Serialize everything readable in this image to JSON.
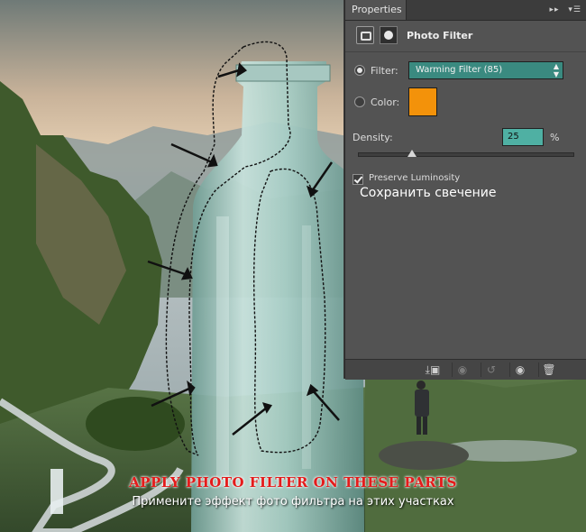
{
  "panel": {
    "tab": "Properties",
    "title": "Photo Filter",
    "filter_label": "Filter:",
    "filter_value": "Warming Filter (85)",
    "color_label": "Color:",
    "swatch_color": "#f3920a",
    "density_label": "Density:",
    "density_value": "25",
    "density_unit": "%",
    "density_level": 0.25,
    "preserve_label": "Preserve Luminosity",
    "preserve_checked": true,
    "preserve_ru": "Сохранить свечение"
  },
  "captions": {
    "en": "APPLY PHOTO FILTER ON THESE PARTS",
    "ru": "Примените эффект фото фильтра на этих участках"
  },
  "icons": [
    "adjustment-layer-icon",
    "layer-mask-icon",
    "clip-to-layer-icon",
    "view-previous-icon",
    "reset-icon",
    "visibility-eye-icon",
    "trash-icon",
    "panel-menu-icon",
    "collapse-panel-icon"
  ],
  "colors": {
    "accent_field": "#3a8a80",
    "accent_input": "#4fb0a3",
    "caption_red": "#e41b1b"
  }
}
